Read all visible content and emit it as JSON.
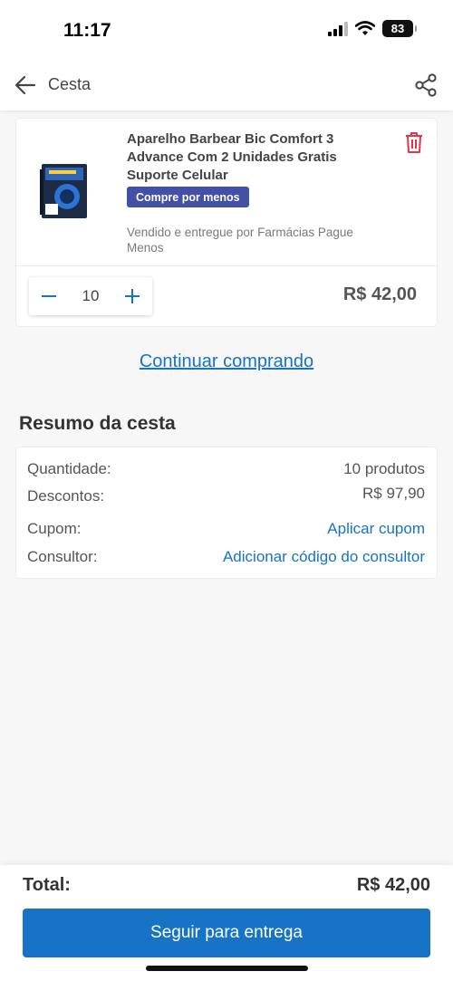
{
  "status_bar": {
    "time": "11:17",
    "battery": "83"
  },
  "header": {
    "title": "Cesta",
    "back_icon": "arrow-left-icon",
    "share_icon": "share-icon"
  },
  "cart_item": {
    "name": "Aparelho Barbear Bic Comfort 3 Advance Com 2 Unidades Gratis Suporte Celular",
    "badge": "Compre por menos",
    "seller": "Vendido e entregue por Farmácias Pague Menos",
    "quantity": "10",
    "price": "R$ 42,00",
    "delete_icon": "trash-icon"
  },
  "continue_label": "Continuar comprando",
  "summary": {
    "title": "Resumo da cesta",
    "quantity_label": "Quantidade:",
    "quantity_value": "10 produtos",
    "discount_label": "Descontos:",
    "discount_value": "R$ 97,90",
    "coupon_label": "Cupom:",
    "coupon_link": "Aplicar cupom",
    "consultant_label": "Consultor:",
    "consultant_link": "Adicionar código do consultor"
  },
  "footer": {
    "total_label": "Total:",
    "total_value": "R$ 42,00",
    "checkout_label": "Seguir para entrega"
  },
  "colors": {
    "accent": "#1673c5",
    "badge": "#4250a6",
    "delete": "#e5334b"
  }
}
